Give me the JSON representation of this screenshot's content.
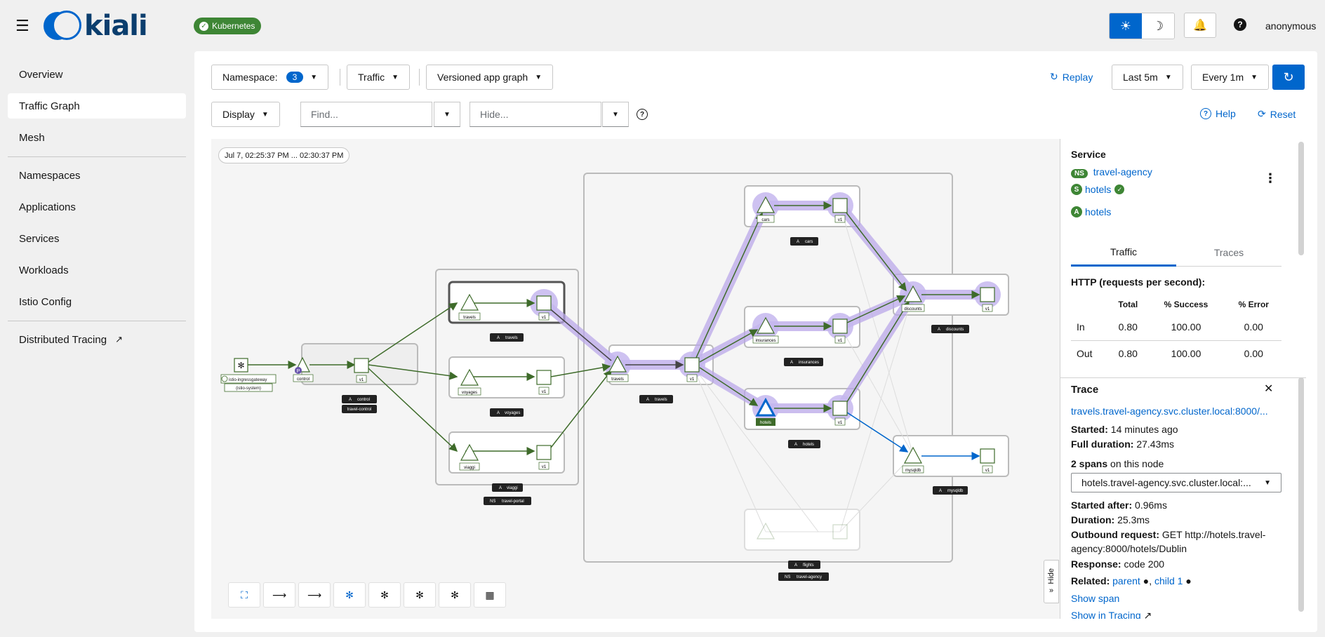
{
  "masthead": {
    "brand": "kiali",
    "cluster_badge": "Kubernetes",
    "user": "anonymous"
  },
  "sidebar": {
    "items": [
      {
        "label": "Overview"
      },
      {
        "label": "Traffic Graph",
        "active": true
      },
      {
        "label": "Mesh"
      },
      {
        "label": "Namespaces"
      },
      {
        "label": "Applications"
      },
      {
        "label": "Services"
      },
      {
        "label": "Workloads"
      },
      {
        "label": "Istio Config"
      },
      {
        "label": "Distributed Tracing"
      }
    ]
  },
  "toolbar": {
    "namespace_label": "Namespace:",
    "namespace_count": "3",
    "traffic_label": "Traffic",
    "graph_type": "Versioned app graph",
    "replay": "Replay",
    "duration": "Last 5m",
    "refresh_interval": "Every 1m",
    "display_label": "Display",
    "find_placeholder": "Find...",
    "hide_placeholder": "Hide...",
    "help": "Help",
    "reset": "Reset"
  },
  "graph": {
    "time_range": "Jul 7, 02:25:37 PM ... 02:30:37 PM",
    "hide_tab": "Hide",
    "labels": {
      "gateway": "istio-ingressgateway",
      "gateway_sub": "(istio-system)",
      "control": "control",
      "travel_control": "travel-control",
      "travels": "travels",
      "voyages": "voyages",
      "viaggi": "viaggi",
      "travel_portal": "travel-portal",
      "v1": "v1",
      "cars": "cars",
      "insurances": "insurances",
      "hotels": "hotels",
      "flights": "flights",
      "discounts": "discounts",
      "mysqldb": "mysqldb",
      "travel_agency": "travel-agency",
      "app_badge": "A",
      "ns_badge": "NS"
    }
  },
  "panel": {
    "heading": "Service",
    "ns_badge": "NS",
    "namespace": "travel-agency",
    "service_badge": "S",
    "service": "hotels",
    "app_badge": "A",
    "app": "hotels",
    "tabs": [
      "Traffic",
      "Traces"
    ],
    "http_title": "HTTP (requests per second):",
    "http_table": {
      "headers": [
        "",
        "Total",
        "% Success",
        "% Error"
      ],
      "rows": [
        [
          "In",
          "0.80",
          "100.00",
          "0.00"
        ],
        [
          "Out",
          "0.80",
          "100.00",
          "0.00"
        ]
      ]
    },
    "trace": {
      "heading": "Trace",
      "trace_link": "travels.travel-agency.svc.cluster.local:8000/...",
      "started_label": "Started:",
      "started": "14 minutes ago",
      "full_duration_label": "Full duration:",
      "full_duration": "27.43ms",
      "spans_count": "2 spans",
      "spans_suffix": "on this node",
      "span_select": "hotels.travel-agency.svc.cluster.local:...",
      "started_after_label": "Started after:",
      "started_after": "0.96ms",
      "duration_label": "Duration:",
      "duration": "25.3ms",
      "outbound_label": "Outbound request:",
      "outbound": "GET http://hotels.travel-agency:8000/hotels/Dublin",
      "response_label": "Response:",
      "response": "code 200",
      "related_label": "Related:",
      "related_parent": "parent",
      "related_child": "child 1",
      "show_span": "Show span",
      "show_in_tracing": "Show in Tracing"
    }
  }
}
